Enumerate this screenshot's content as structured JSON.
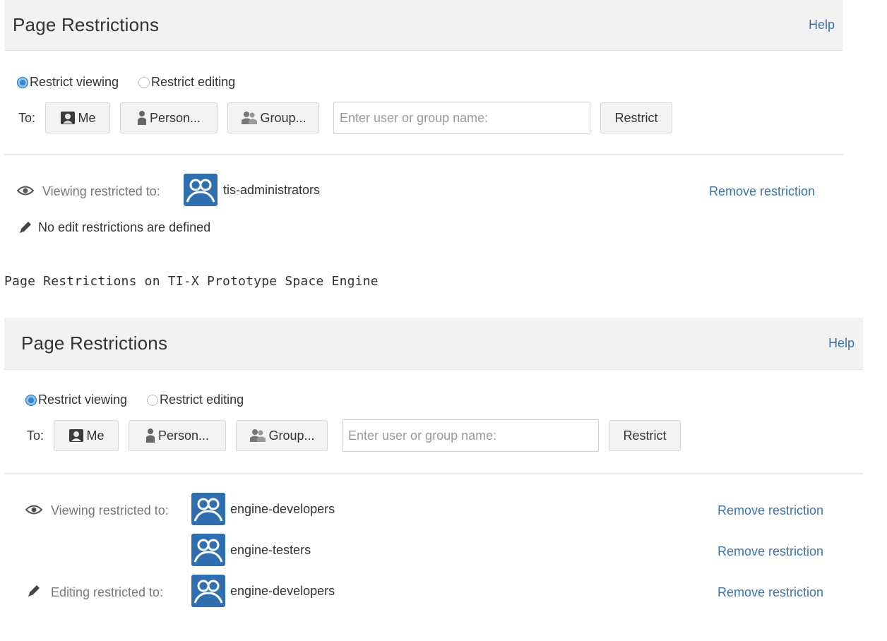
{
  "panel1": {
    "title": "Page Restrictions",
    "help": "Help",
    "radio_view": "Restrict viewing",
    "radio_edit": "Restrict editing",
    "to_label": "To:",
    "btn_me": "Me",
    "btn_person": "Person...",
    "btn_group": "Group...",
    "input_placeholder": "Enter user or group name:",
    "btn_restrict": "Restrict",
    "viewing_label": "Viewing restricted to:",
    "viewing_group": "tis-administrators",
    "remove": "Remove restriction",
    "no_edit": "No edit restrictions are defined"
  },
  "caption": "Page Restrictions on TI-X Prototype Space Engine",
  "panel2": {
    "title": "Page Restrictions",
    "help": "Help",
    "radio_view": "Restrict viewing",
    "radio_edit": "Restrict editing",
    "to_label": "To:",
    "btn_me": "Me",
    "btn_person": "Person...",
    "btn_group": "Group...",
    "input_placeholder": "Enter user or group name:",
    "btn_restrict": "Restrict",
    "viewing_label": "Viewing restricted to:",
    "editing_label": "Editing restricted to:",
    "restrictions": [
      {
        "group": "engine-developers",
        "remove": "Remove restriction"
      },
      {
        "group": "engine-testers",
        "remove": "Remove restriction"
      },
      {
        "group": "engine-developers",
        "remove": "Remove restriction"
      }
    ]
  },
  "colors": {
    "link": "#3b73af",
    "header_bg": "#f2f2f2",
    "group_icon": "#2f6fb0",
    "radio_selected": "#2e86d4"
  },
  "icons": {
    "eye": "eye-icon",
    "pencil": "pencil-icon",
    "group": "group-icon",
    "person": "person-icon",
    "me": "me-icon"
  }
}
